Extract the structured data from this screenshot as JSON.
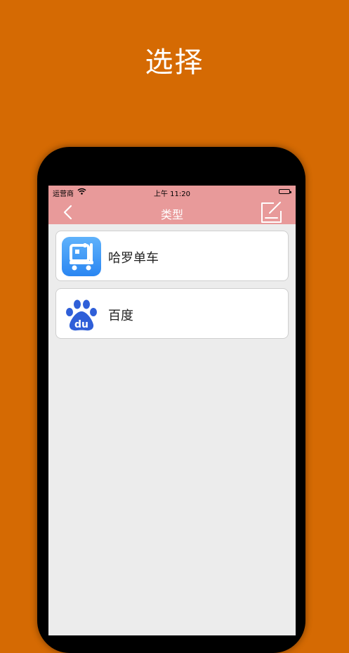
{
  "headline": "选择",
  "status_bar": {
    "carrier": "运营商",
    "time": "上午 11:20"
  },
  "nav": {
    "title": "类型",
    "back_icon": "chevron-left-icon",
    "action_icon": "edit-note-icon"
  },
  "items": [
    {
      "label": "哈罗单车",
      "icon": "hellobike-app-icon"
    },
    {
      "label": "百度",
      "icon": "baidu-app-icon"
    }
  ],
  "colors": {
    "background": "#d56a03",
    "nav_bar": "#e89a9a",
    "screen": "#ececec"
  }
}
